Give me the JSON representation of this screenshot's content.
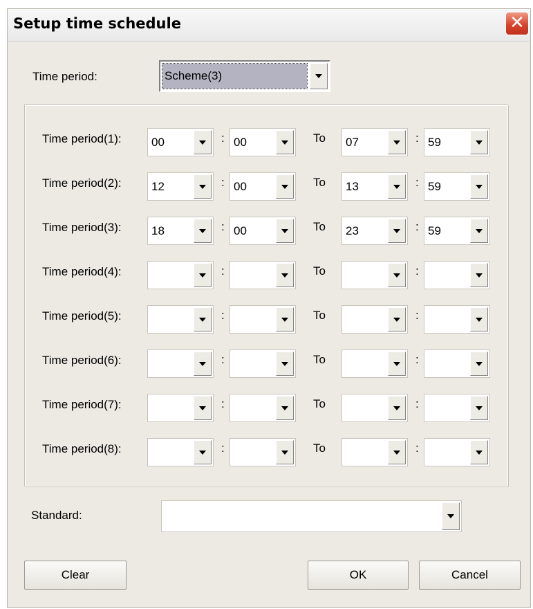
{
  "window": {
    "title": "Setup time schedule",
    "close_glyph": "✕"
  },
  "time_period": {
    "label": "Time period:",
    "selected": "Scheme(3)"
  },
  "periods": [
    {
      "label": "Time period(1):",
      "from_hour": "00",
      "from_min": "00",
      "to_hour": "07",
      "to_min": "59"
    },
    {
      "label": "Time period(2):",
      "from_hour": "12",
      "from_min": "00",
      "to_hour": "13",
      "to_min": "59"
    },
    {
      "label": "Time period(3):",
      "from_hour": "18",
      "from_min": "00",
      "to_hour": "23",
      "to_min": "59"
    },
    {
      "label": "Time period(4):",
      "from_hour": "",
      "from_min": "",
      "to_hour": "",
      "to_min": ""
    },
    {
      "label": "Time period(5):",
      "from_hour": "",
      "from_min": "",
      "to_hour": "",
      "to_min": ""
    },
    {
      "label": "Time period(6):",
      "from_hour": "",
      "from_min": "",
      "to_hour": "",
      "to_min": ""
    },
    {
      "label": "Time period(7):",
      "from_hour": "",
      "from_min": "",
      "to_hour": "",
      "to_min": ""
    },
    {
      "label": "Time period(8):",
      "from_hour": "",
      "from_min": "",
      "to_hour": "",
      "to_min": ""
    }
  ],
  "separators": {
    "colon": ":",
    "to": "To"
  },
  "standard": {
    "label": "Standard:",
    "selected": ""
  },
  "buttons": {
    "clear": "Clear",
    "ok": "OK",
    "cancel": "Cancel"
  },
  "colors": {
    "close_button": "#d8452e",
    "dialog_bg": "#eceae3",
    "selection_highlight": "#b3b3c2"
  },
  "icons": {
    "close": "close-icon",
    "dropdown": "chevron-down-icon"
  }
}
